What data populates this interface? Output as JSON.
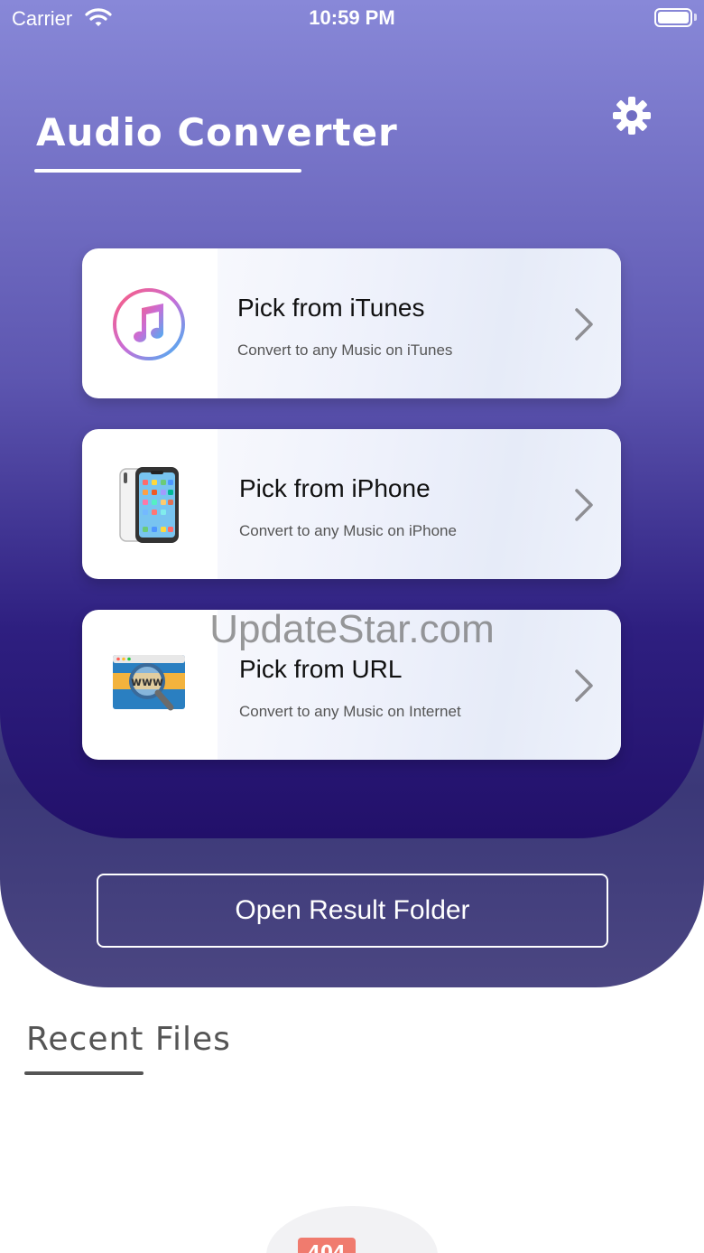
{
  "status_bar": {
    "carrier": "Carrier",
    "time": "10:59 PM",
    "wifi_icon": "wifi-icon",
    "battery_icon": "battery-icon"
  },
  "header": {
    "title": "Audio Converter",
    "settings_icon": "gear-icon"
  },
  "options": [
    {
      "title": "Pick from iTunes",
      "subtitle": "Convert to any Music on iTunes",
      "icon": "itunes-icon"
    },
    {
      "title": "Pick from iPhone",
      "subtitle": "Convert to any Music on iPhone",
      "icon": "iphone-icon"
    },
    {
      "title": "Pick from URL",
      "subtitle": "Convert to any Music on Internet",
      "icon": "www-search-icon"
    }
  ],
  "watermark": "UpdateStar.com",
  "open_folder_label": "Open Result Folder",
  "recent": {
    "title": "Recent Files",
    "empty_badge": "404"
  },
  "colors": {
    "hero_top": "#8888d8",
    "hero_bottom": "#22106a",
    "card_text": "#111111"
  }
}
